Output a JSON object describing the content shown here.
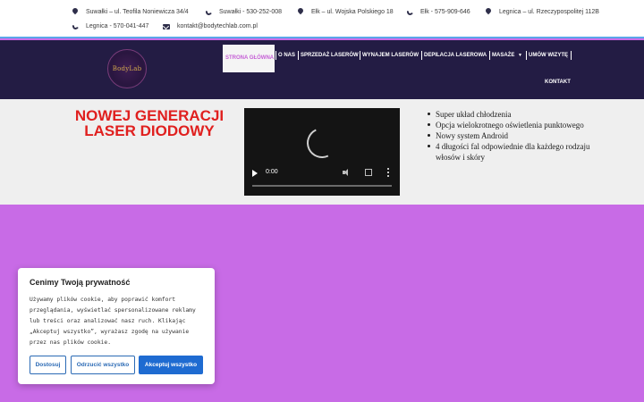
{
  "topbar": {
    "row1": [
      {
        "icon": "map-pin-icon",
        "text": "Suwałki – ul. Teofila Noniewicza 34/4"
      },
      {
        "icon": "phone-icon",
        "text": "Suwałki - 530-252-008"
      },
      {
        "icon": "map-pin-icon",
        "text": "Ełk – ul. Wojska Polskiego 18"
      },
      {
        "icon": "phone-icon",
        "text": "Ełk - 575-909-646"
      },
      {
        "icon": "map-pin-icon",
        "text": "Legnica – ul. Rzeczypospolitej 112B"
      }
    ],
    "row2": [
      {
        "icon": "phone-icon",
        "text": "Legnica - 570-041-447"
      },
      {
        "icon": "mail-icon",
        "text": "kontakt@bodytechlab.com.pl"
      }
    ]
  },
  "nav": {
    "logo_text": "BodyLab",
    "items": [
      "STRONA GŁÓWNA",
      "O NAS",
      "SPRZEDAŻ LASERÓW",
      "WYNAJEM LASERÓW",
      "DEPILACJA LASEROWA",
      "MASAŻE",
      "UMÓW WIZYTĘ",
      "KONTAKT"
    ]
  },
  "hero": {
    "title": "NOWEJ GENERACJI LASER DIODOWY",
    "video": {
      "time": "0:00"
    },
    "features": [
      "Super układ chłodzenia",
      "Opcja wielokrotnego oświetlenia punktowego",
      "Nowy system Android",
      "4 długości fal odpowiednie dla każdego rodzaju włosów i skóry"
    ]
  },
  "cookie": {
    "title": "Cenimy Twoją prywatność",
    "text": "Używamy plików cookie, aby poprawić komfort przeglądania, wyświetlać spersonalizowane reklamy lub treści oraz analizować nasz ruch. Klikając „Akceptuj wszystko”, wyrażasz zgodę na używanie przez nas plików cookie.",
    "customize": "Dostosuj",
    "reject": "Odrzucić wszystko",
    "accept": "Akceptuj wszystko"
  },
  "colors": {
    "nav_bg": "#231c44",
    "accent_purple": "#c86be6",
    "title_red": "#e0201f",
    "button_blue": "#1e6bd1"
  }
}
